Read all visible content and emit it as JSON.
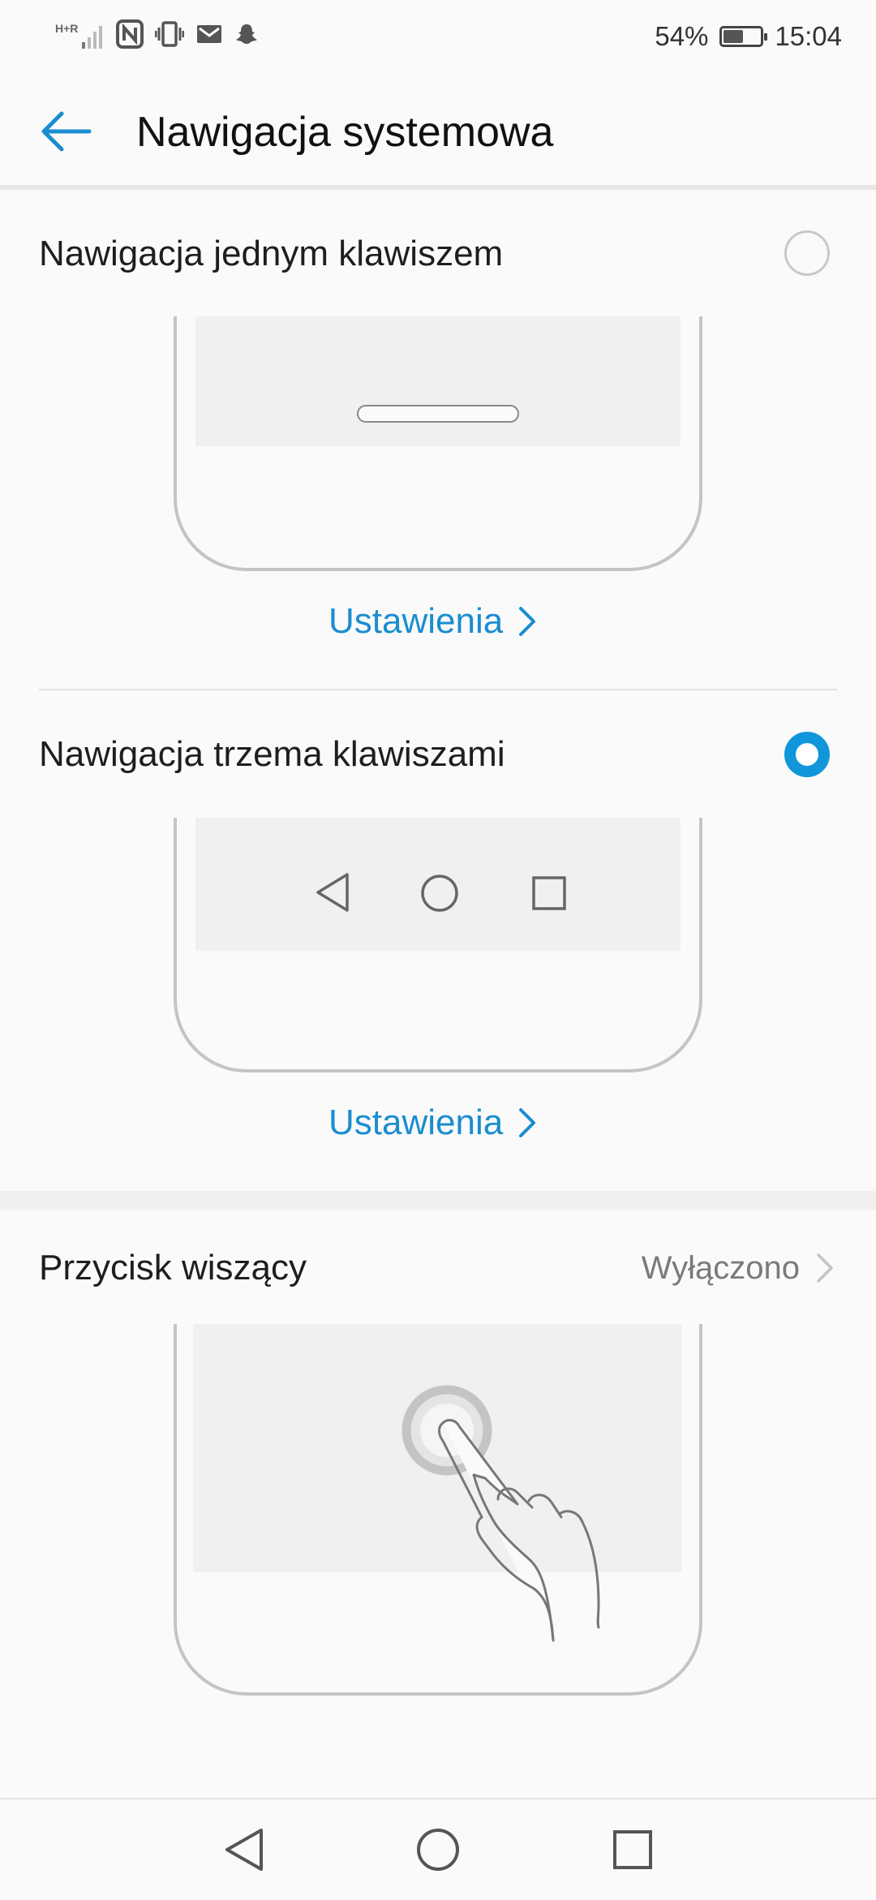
{
  "status_bar": {
    "network_label": "H+R",
    "battery_percent_label": "54%",
    "battery_level": 0.54,
    "time": "15:04",
    "icons": [
      "signal-icon",
      "nfc-icon",
      "vibrate-icon",
      "gmail-icon",
      "snapchat-icon"
    ]
  },
  "header": {
    "title": "Nawigacja systemowa",
    "back_icon": "arrow-left-icon"
  },
  "options": [
    {
      "title": "Nawigacja jednym klawiszem",
      "selected": false,
      "settings_label": "Ustawienia"
    },
    {
      "title": "Nawigacja trzema klawiszami",
      "selected": true,
      "settings_label": "Ustawienia"
    }
  ],
  "floating_button": {
    "title": "Przycisk wiszący",
    "value": "Wyłączono"
  },
  "colors": {
    "accent": "#1296db",
    "link": "#1a8dd0",
    "frame": "#c4c4c4",
    "screen": "#f0f0f0"
  }
}
